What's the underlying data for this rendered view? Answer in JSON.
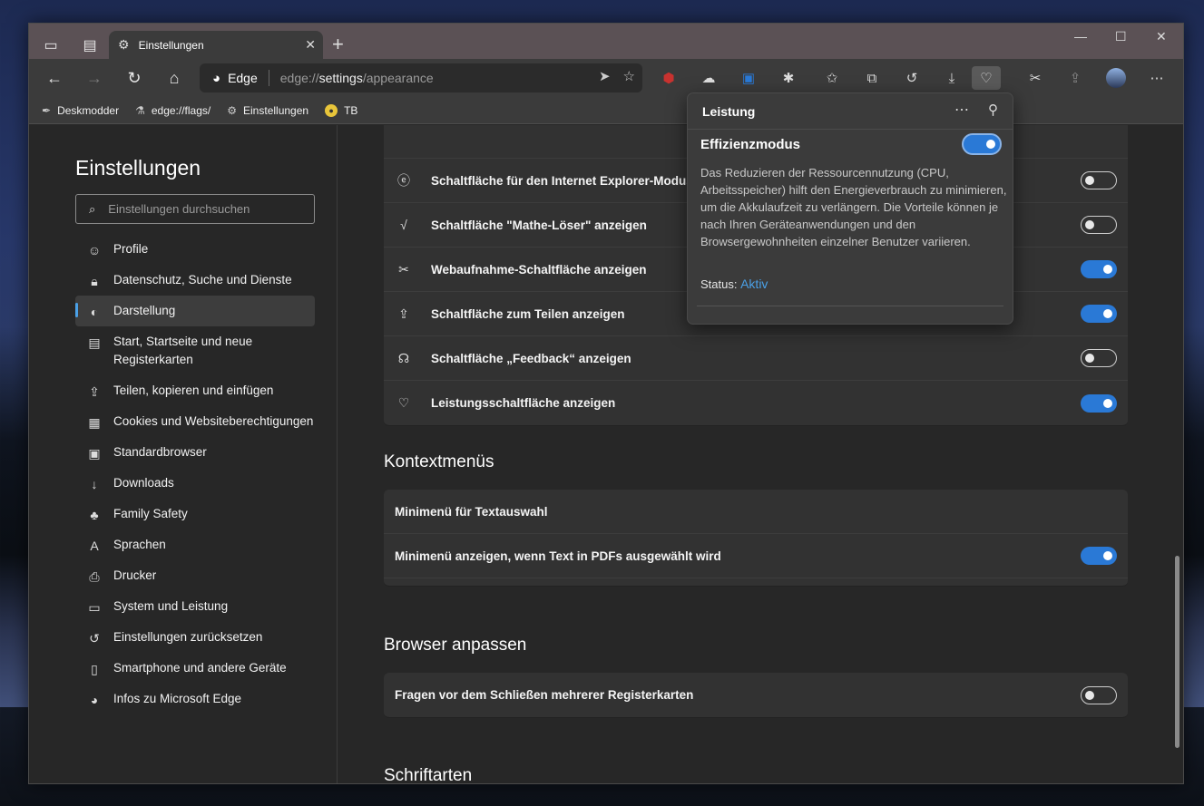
{
  "tab": {
    "title": "Einstellungen"
  },
  "address": {
    "brand": "Edge",
    "url_prefix": "edge://",
    "url_bold": "settings",
    "url_suffix": "/appearance"
  },
  "bookmarks": [
    {
      "label": "Deskmodder",
      "icon": "pen-icon"
    },
    {
      "label": "edge://flags/",
      "icon": "flask-icon"
    },
    {
      "label": "Einstellungen",
      "icon": "gear-icon"
    },
    {
      "label": "TB",
      "icon": "coin-icon"
    }
  ],
  "sidebar": {
    "title": "Einstellungen",
    "search_placeholder": "Einstellungen durchsuchen",
    "items": [
      {
        "label": "Profile"
      },
      {
        "label": "Datenschutz, Suche und Dienste"
      },
      {
        "label": "Darstellung"
      },
      {
        "label": "Start, Startseite und neue Registerkarten"
      },
      {
        "label": "Teilen, kopieren und einfügen"
      },
      {
        "label": "Cookies und Websiteberechtigungen"
      },
      {
        "label": "Standardbrowser"
      },
      {
        "label": "Downloads"
      },
      {
        "label": "Family Safety"
      },
      {
        "label": "Sprachen"
      },
      {
        "label": "Drucker"
      },
      {
        "label": "System und Leistung"
      },
      {
        "label": "Einstellungen zurücksetzen"
      },
      {
        "label": "Smartphone und andere Geräte"
      },
      {
        "label": "Infos zu Microsoft Edge"
      }
    ]
  },
  "toolbar_card": {
    "rows": [
      {
        "label": "Schaltfläche für den Internet Explorer-Modus anzeigen",
        "on": false
      },
      {
        "label": "Schaltfläche \"Mathe-Löser\" anzeigen",
        "on": false
      },
      {
        "label": "Webaufnahme-Schaltfläche anzeigen",
        "on": true
      },
      {
        "label": "Schaltfläche zum Teilen anzeigen",
        "on": true
      },
      {
        "label": "Schaltfläche „Feedback“ anzeigen",
        "on": false
      },
      {
        "label": "Leistungsschaltfläche anzeigen",
        "on": true
      }
    ]
  },
  "context_menus": {
    "heading": "Kontextmenüs",
    "rows": [
      {
        "label": "Minimenü für Textauswahl"
      },
      {
        "label": "Minimenü anzeigen, wenn Text in PDFs ausgewählt wird",
        "on": true
      }
    ]
  },
  "browser_customize": {
    "heading": "Browser anpassen",
    "rows": [
      {
        "label": "Fragen vor dem Schließen mehrerer Registerkarten",
        "on": false
      }
    ]
  },
  "fonts": {
    "heading": "Schriftarten"
  },
  "flyout": {
    "title": "Leistung",
    "subtitle": "Effizienzmodus",
    "description": "Das Reduzieren der Ressourcennutzung (CPU, Arbeitsspeicher) hilft den Energieverbrauch zu minimieren, um die Akkulaufzeit zu verlängern. Die Vorteile können je nach Ihren Geräteanwendungen und den Browsergewohnheiten einzelner Benutzer variieren.",
    "status_label": "Status:",
    "status_value": "Aktiv",
    "enabled": true
  },
  "colors": {
    "accent": "#2a79d6",
    "link": "#4aa0e6",
    "titlebar": "#5b5155"
  }
}
